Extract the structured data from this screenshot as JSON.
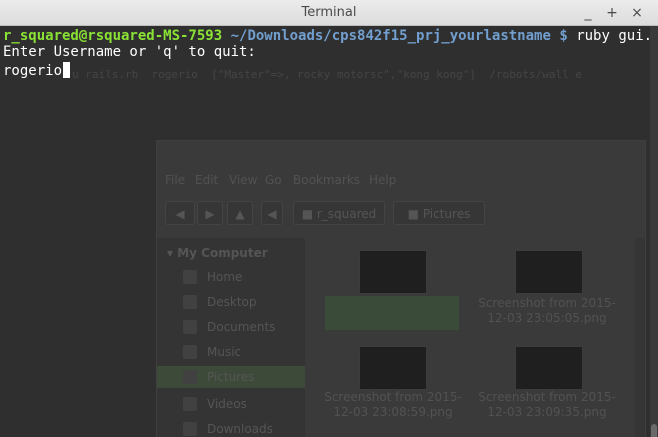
{
  "window": {
    "title": "Terminal",
    "buttons": {
      "minimize": "_",
      "maximize": "+",
      "close": "×"
    }
  },
  "terminal": {
    "prompt_user": "r_squared@rsquared-MS-7593",
    "prompt_path": "~/Downloads/cps842f15_prj_yourlastname",
    "prompt_symbol": "$",
    "command": "ruby gui.rb",
    "output_line": "Enter Username or 'q' to quit:",
    "input_value": "rogerio",
    "ghost_text": "u rails.rb  rogerio  [\"Master\"=>, rocky motorsc\",\"kong kong\"]  /robots/wall e"
  },
  "background_window": {
    "menu": [
      "File",
      "Edit",
      "View",
      "Go",
      "Bookmarks",
      "Help"
    ],
    "toolbar": {
      "location": "r_squared",
      "folder": "Pictures"
    },
    "sidebar_heading": "My Computer",
    "sidebar_items": [
      "Home",
      "Desktop",
      "Documents",
      "Music",
      "Pictures",
      "Videos",
      "Downloads"
    ],
    "files": [
      {
        "caption": ""
      },
      {
        "caption": "Screenshot from 2015-12-03 23:05:05.png"
      },
      {
        "caption": "Screenshot from 2015-12-03 23:08:59.png"
      },
      {
        "caption": "Screenshot from 2015-12-03 23:09:35.png"
      }
    ]
  },
  "colors": {
    "prompt_user": "#8ae234",
    "prompt_path": "#729fcf",
    "terminal_bg": "#2f2f2f",
    "text": "#ffffff"
  },
  "icons": [
    "minimize-icon",
    "maximize-icon",
    "close-icon",
    "folder-icon"
  ]
}
